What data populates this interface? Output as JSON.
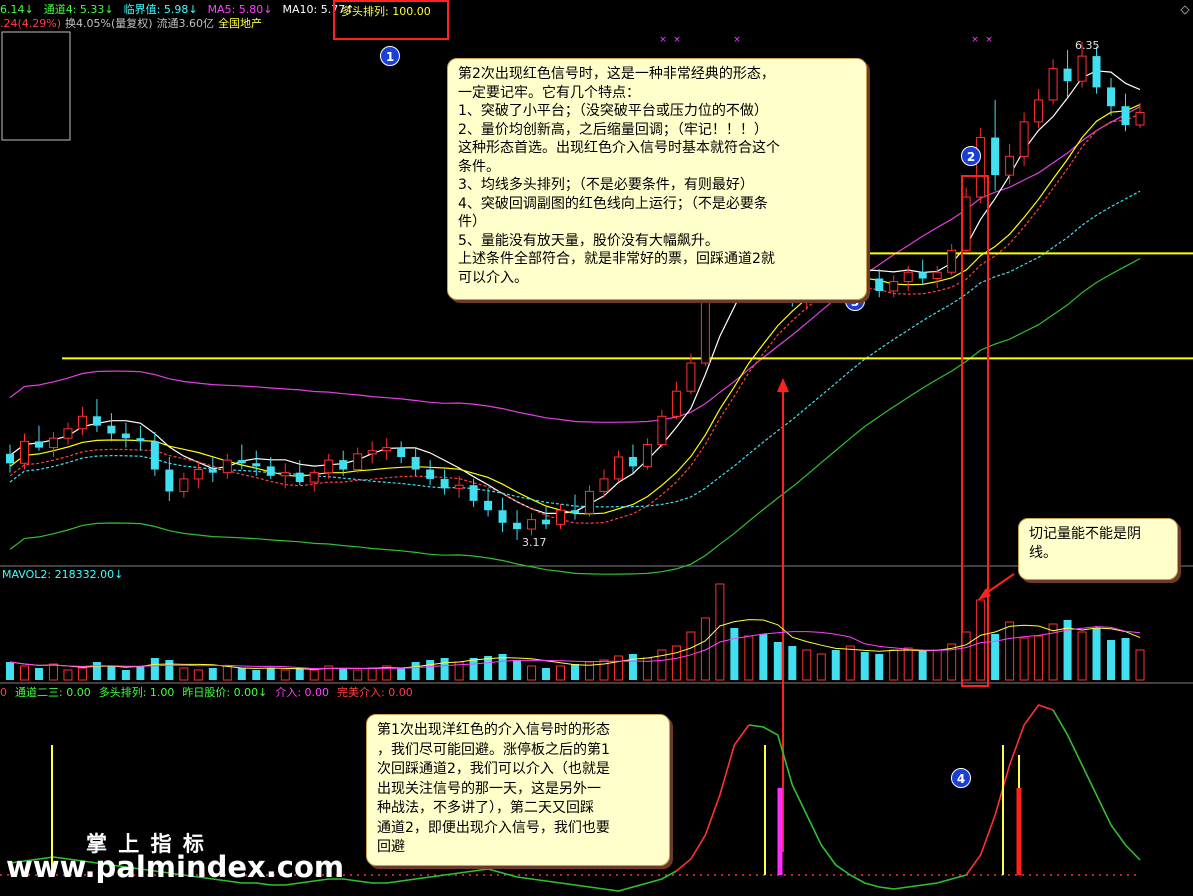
{
  "header": {
    "row1": [
      {
        "text": "6.14↓",
        "color": "#40ff40"
      },
      {
        "text": "通道4: 5.33↓",
        "color": "#40ff40"
      },
      {
        "text": "临界值: 5.98↓",
        "color": "#40ffff"
      },
      {
        "text": "MA5: 5.80↓",
        "color": "#ff40ff"
      },
      {
        "text": "MA10: 5.77↑",
        "color": "#ffffff"
      }
    ],
    "row1_boxed": {
      "text": "多头排列: 100.00",
      "color": "#ffff40"
    },
    "row2": [
      {
        "text": ".24(4.29%)",
        "color": "#ff4040"
      },
      {
        "text": "换4.05%(量复权)",
        "color": "#c0c0c0"
      },
      {
        "text": "流通3.60亿",
        "color": "#c0c0c0"
      },
      {
        "text": "全国地产",
        "color": "#ffff40"
      }
    ]
  },
  "mid_header": {
    "text": "MAVOL2: 218332.00↓",
    "color": "#40ffff"
  },
  "sub_header": [
    {
      "text": "0",
      "color": "#ff4040"
    },
    {
      "text": "通道二三: 0.00",
      "color": "#40ff40"
    },
    {
      "text": "多头排列: 1.00",
      "color": "#40ff40"
    },
    {
      "text": "昨日股价: 0.00↓",
      "color": "#40ff40"
    },
    {
      "text": "介入: 0.00",
      "color": "#ff40ff"
    },
    {
      "text": "完美介入: 0.00",
      "color": "#ff4040"
    }
  ],
  "price_labels": {
    "high": "6.35",
    "low": "3.17"
  },
  "badges": [
    "1",
    "2",
    "3",
    "4"
  ],
  "callout_top": {
    "lines": [
      "第2次出现红色信号时，这是一种非常经典的形态，",
      "一定要记牢。它有几个特点：",
      "1、突破了小平台；（没突破平台或压力位的不做）",
      "2、量价均创新高，之后缩量回调；（牢记！！！）",
      "这种形态首选。出现红色介入信号时基本就符合这个",
      "条件。",
      "3、均线多头排列；（不是必要条件，有则最好）",
      "4、突破回调副图的红色线向上运行；（不是必要条",
      "件）",
      "5、量能没有放天量，股价没有大幅飙升。",
      "上述条件全部符合，就是非常好的票，回踩通道2就",
      "可以介入。"
    ]
  },
  "callout_right": {
    "lines": [
      "切记量能不能是阴",
      "线。"
    ]
  },
  "callout_bottom": {
    "lines": [
      "第1次出现洋红色的介入信号时的形态",
      "，我们尽可能回避。涨停板之后的第1",
      "次回踩通道2，我们可以介入（也就是",
      "出现关注信号的那一天，这是另外一",
      "种战法，不多讲了），第二天又回踩",
      "通道2，即便出现介入信号，我们也要",
      "回避"
    ]
  },
  "brand": {
    "cn": "掌 上 指 标",
    "url": "www.palmindex.com"
  },
  "colors": {
    "up": "#ff3030",
    "down": "#40e0f0",
    "ma_white": "#ffffff",
    "ma_yellow": "#ffff00",
    "upper_band": "#e040e0",
    "lower_band": "#30c030",
    "level": "#ffff00",
    "frame": "#ff2020"
  },
  "chart_data": {
    "type": "candlestick",
    "ohlc": [
      [
        3.72,
        3.78,
        3.6,
        3.66
      ],
      [
        3.66,
        3.85,
        3.62,
        3.8
      ],
      [
        3.8,
        3.9,
        3.74,
        3.76
      ],
      [
        3.76,
        3.86,
        3.7,
        3.82
      ],
      [
        3.82,
        3.92,
        3.78,
        3.88
      ],
      [
        3.88,
        4.02,
        3.84,
        3.96
      ],
      [
        3.96,
        4.07,
        3.86,
        3.9
      ],
      [
        3.9,
        3.98,
        3.8,
        3.85
      ],
      [
        3.85,
        3.92,
        3.76,
        3.82
      ],
      [
        3.82,
        3.9,
        3.74,
        3.8
      ],
      [
        3.8,
        3.86,
        3.58,
        3.62
      ],
      [
        3.62,
        3.7,
        3.42,
        3.48
      ],
      [
        3.48,
        3.6,
        3.44,
        3.56
      ],
      [
        3.56,
        3.66,
        3.5,
        3.62
      ],
      [
        3.62,
        3.7,
        3.54,
        3.6
      ],
      [
        3.6,
        3.72,
        3.56,
        3.68
      ],
      [
        3.68,
        3.78,
        3.62,
        3.66
      ],
      [
        3.66,
        3.74,
        3.58,
        3.64
      ],
      [
        3.64,
        3.7,
        3.56,
        3.58
      ],
      [
        3.58,
        3.66,
        3.5,
        3.6
      ],
      [
        3.6,
        3.68,
        3.52,
        3.54
      ],
      [
        3.54,
        3.62,
        3.48,
        3.6
      ],
      [
        3.6,
        3.72,
        3.56,
        3.68
      ],
      [
        3.68,
        3.74,
        3.58,
        3.62
      ],
      [
        3.62,
        3.76,
        3.6,
        3.72
      ],
      [
        3.72,
        3.8,
        3.66,
        3.74
      ],
      [
        3.74,
        3.82,
        3.68,
        3.76
      ],
      [
        3.76,
        3.8,
        3.66,
        3.7
      ],
      [
        3.7,
        3.76,
        3.58,
        3.62
      ],
      [
        3.62,
        3.68,
        3.52,
        3.56
      ],
      [
        3.56,
        3.62,
        3.46,
        3.5
      ],
      [
        3.5,
        3.58,
        3.44,
        3.52
      ],
      [
        3.52,
        3.56,
        3.38,
        3.42
      ],
      [
        3.42,
        3.5,
        3.32,
        3.36
      ],
      [
        3.36,
        3.44,
        3.22,
        3.28
      ],
      [
        3.28,
        3.36,
        3.17,
        3.24
      ],
      [
        3.24,
        3.34,
        3.2,
        3.3
      ],
      [
        3.3,
        3.38,
        3.24,
        3.27
      ],
      [
        3.27,
        3.4,
        3.24,
        3.36
      ],
      [
        3.36,
        3.46,
        3.3,
        3.34
      ],
      [
        3.34,
        3.52,
        3.32,
        3.48
      ],
      [
        3.48,
        3.62,
        3.44,
        3.56
      ],
      [
        3.56,
        3.74,
        3.54,
        3.7
      ],
      [
        3.7,
        3.78,
        3.6,
        3.64
      ],
      [
        3.64,
        3.82,
        3.62,
        3.78
      ],
      [
        3.78,
        4.0,
        3.76,
        3.96
      ],
      [
        3.96,
        4.18,
        3.94,
        4.12
      ],
      [
        4.12,
        4.36,
        4.1,
        4.3
      ],
      [
        4.3,
        4.8,
        4.28,
        4.73
      ],
      [
        4.73,
        5.2,
        4.7,
        5.0
      ],
      [
        5.0,
        5.08,
        4.82,
        4.9
      ],
      [
        4.9,
        5.12,
        4.86,
        5.06
      ],
      [
        5.06,
        5.12,
        4.88,
        4.92
      ],
      [
        4.92,
        4.98,
        4.78,
        4.82
      ],
      [
        4.82,
        4.88,
        4.66,
        4.7
      ],
      [
        4.7,
        4.82,
        4.64,
        4.78
      ],
      [
        4.78,
        4.9,
        4.74,
        4.86
      ],
      [
        4.86,
        4.94,
        4.78,
        4.82
      ],
      [
        4.82,
        4.96,
        4.8,
        4.92
      ],
      [
        4.92,
        4.98,
        4.8,
        4.84
      ],
      [
        4.84,
        4.9,
        4.72,
        4.76
      ],
      [
        4.76,
        4.86,
        4.72,
        4.82
      ],
      [
        4.82,
        4.92,
        4.76,
        4.88
      ],
      [
        4.88,
        4.96,
        4.8,
        4.84
      ],
      [
        4.84,
        4.92,
        4.78,
        4.88
      ],
      [
        4.88,
        5.06,
        4.86,
        5.02
      ],
      [
        5.02,
        5.42,
        5.0,
        5.36
      ],
      [
        5.36,
        5.8,
        5.32,
        5.74
      ],
      [
        5.74,
        5.98,
        5.4,
        5.5
      ],
      [
        5.5,
        5.7,
        5.44,
        5.62
      ],
      [
        5.62,
        5.9,
        5.56,
        5.84
      ],
      [
        5.84,
        6.05,
        5.8,
        5.98
      ],
      [
        5.98,
        6.24,
        5.95,
        6.18
      ],
      [
        6.18,
        6.3,
        6.0,
        6.1
      ],
      [
        6.1,
        6.35,
        6.06,
        6.26
      ],
      [
        6.26,
        6.32,
        6.02,
        6.06
      ],
      [
        6.06,
        6.12,
        5.88,
        5.94
      ],
      [
        5.94,
        6.02,
        5.78,
        5.82
      ],
      [
        5.82,
        5.96,
        5.8,
        5.9
      ]
    ],
    "volume_colors_note": "red = up day, cyan = down day",
    "levels": [
      4.33,
      5.0
    ],
    "sub_series_note": "oscillator with signal bars"
  }
}
